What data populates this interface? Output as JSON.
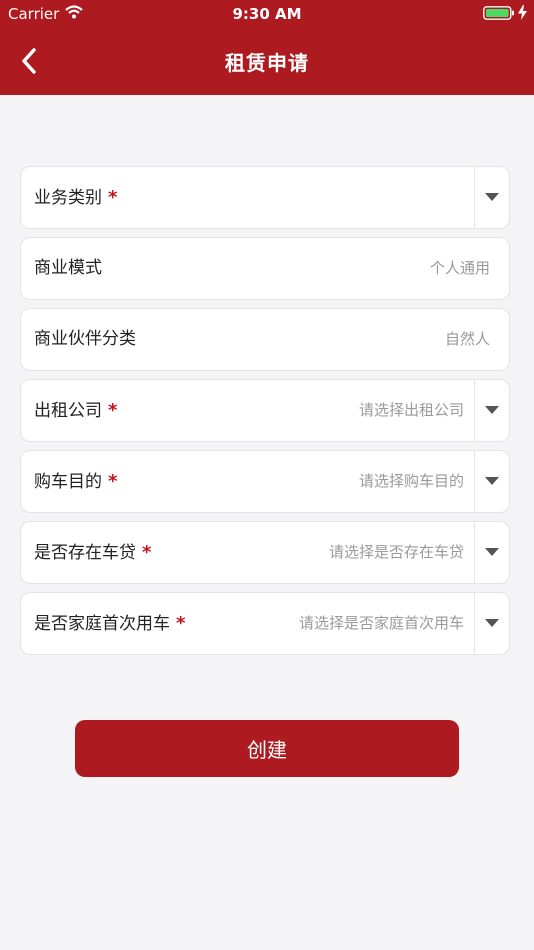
{
  "status_bar": {
    "carrier": "Carrier",
    "time": "9:30 AM"
  },
  "header": {
    "title": "租赁申请",
    "back_icon": "chevron-left-icon"
  },
  "form": {
    "fields": [
      {
        "label": "业务类别",
        "required_mark": "*",
        "value": ""
      },
      {
        "label": "商业模式",
        "value": "个人通用"
      },
      {
        "label": "商业伙伴分类",
        "value": "自然人"
      },
      {
        "label": "出租公司",
        "required_mark": "*",
        "placeholder": "请选择出租公司"
      },
      {
        "label": "购车目的",
        "required_mark": "*",
        "placeholder": "请选择购车目的"
      },
      {
        "label": "是否存在车贷",
        "required_mark": "*",
        "placeholder": "请选择是否存在车贷"
      },
      {
        "label": "是否家庭首次用车",
        "required_mark": "*",
        "placeholder": "请选择是否家庭首次用车"
      }
    ]
  },
  "create_button": {
    "label": "创建"
  },
  "colors": {
    "brand": "#ad1a1f",
    "required": "#c3121b",
    "background": "#f4f4f7"
  }
}
